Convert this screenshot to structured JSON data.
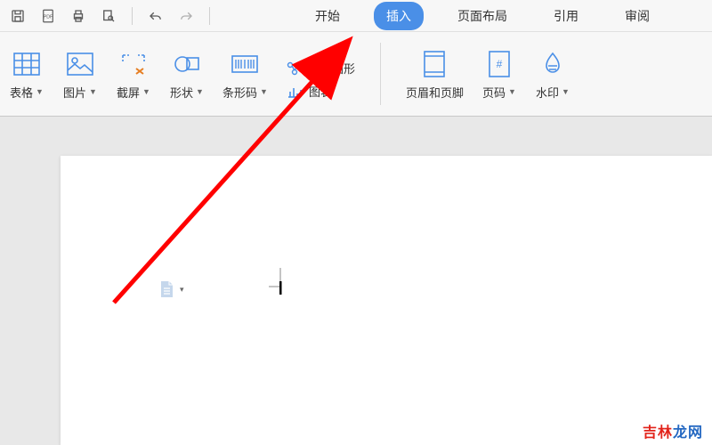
{
  "qat": {
    "save": "保存",
    "pdf": "PDF",
    "print": "打印",
    "preview": "预览",
    "undo": "撤销",
    "redo": "重做"
  },
  "tabs": {
    "start": "开始",
    "insert": "插入",
    "layout": "页面布局",
    "reference": "引用",
    "review": "审阅"
  },
  "ribbon": {
    "table": "表格",
    "picture": "图片",
    "screenshot": "截屏",
    "shapes": "形状",
    "barcode": "条形码",
    "smartart": "智能图形",
    "chart": "图表",
    "header_footer": "页眉和页脚",
    "page_number": "页码",
    "watermark": "水印"
  },
  "watermark_text": "吉林龙网",
  "colors": {
    "accent": "#4a8fe7",
    "arrow": "#ff0000"
  }
}
